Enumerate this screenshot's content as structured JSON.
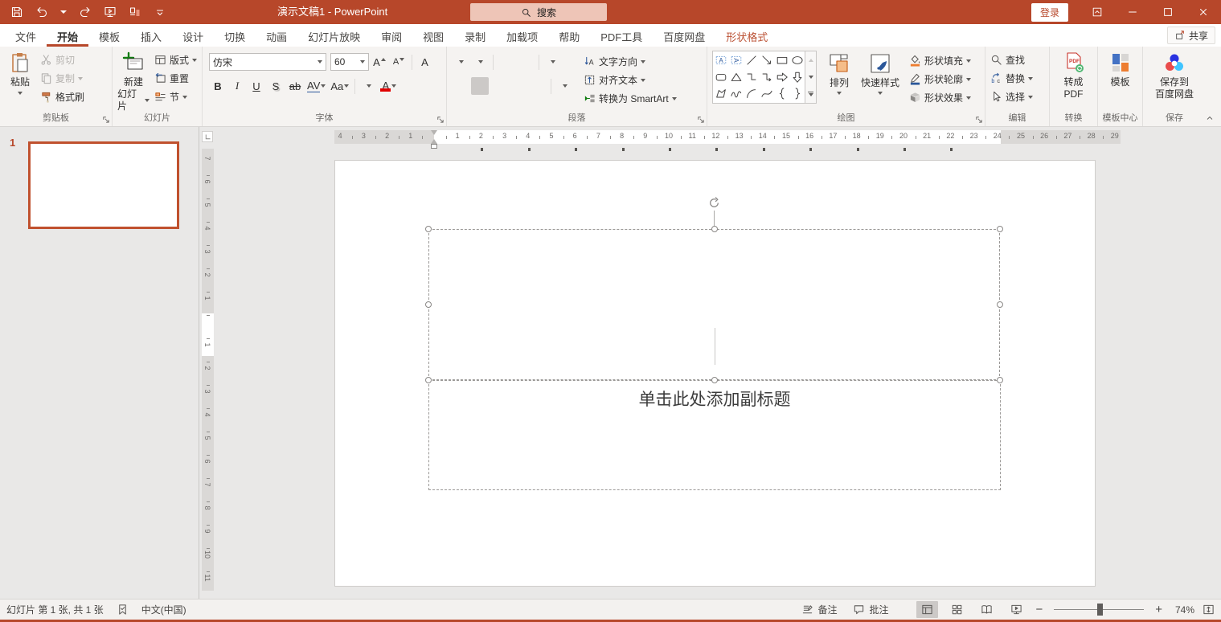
{
  "colors": {
    "accent": "#b7472a",
    "contextual_tab": "#bb5134",
    "thumb_border": "#c0512e",
    "highlight": "#ffff00",
    "font_color": "#e00000"
  },
  "titlebar": {
    "title": "演示文稿1 - PowerPoint",
    "search": "搜索",
    "login": "登录"
  },
  "tabs": [
    {
      "label": "文件"
    },
    {
      "label": "开始",
      "active": true
    },
    {
      "label": "模板"
    },
    {
      "label": "插入"
    },
    {
      "label": "设计"
    },
    {
      "label": "切换"
    },
    {
      "label": "动画"
    },
    {
      "label": "幻灯片放映"
    },
    {
      "label": "审阅"
    },
    {
      "label": "视图"
    },
    {
      "label": "录制"
    },
    {
      "label": "加载项"
    },
    {
      "label": "帮助"
    },
    {
      "label": "PDF工具"
    },
    {
      "label": "百度网盘"
    },
    {
      "label": "形状格式",
      "contextual": true
    }
  ],
  "share": "共享",
  "ribbon": {
    "clipboard": {
      "label": "剪贴板",
      "paste": "粘贴",
      "cut": "剪切",
      "copy": "复制",
      "format_painter": "格式刷"
    },
    "slides": {
      "label": "幻灯片",
      "new_slide_l1": "新建",
      "new_slide_l2": "幻灯片",
      "layout": "版式",
      "reset": "重置",
      "section": "节"
    },
    "font": {
      "label": "字体",
      "family": "仿宋",
      "size": "60",
      "bold": "B",
      "italic": "I",
      "underline": "U",
      "shadow": "S",
      "strike": "ab",
      "spacing": "AV",
      "case": "Aa",
      "grow": "A",
      "shrink": "A",
      "clear": "A",
      "color_letter": "A"
    },
    "paragraph": {
      "label": "段落",
      "text_direction": "文字方向",
      "align_text": "对齐文本",
      "smartart": "转换为 SmartArt"
    },
    "drawing": {
      "label": "绘图",
      "arrange": "排列",
      "quick_styles": "快速样式",
      "fill": "形状填充",
      "outline": "形状轮廓",
      "effects": "形状效果",
      "shapes": [
        "text-box",
        "vertical-text-box",
        "line",
        "arrow",
        "rectangle",
        "oval",
        "rounded-rectangle",
        "triangle",
        "elbow-connector",
        "elbow-arrow-connector",
        "right-arrow",
        "down-arrow",
        "freeform",
        "scribble",
        "arc",
        "curve",
        "left-brace",
        "right-brace"
      ]
    },
    "editing": {
      "label": "编辑",
      "find": "查找",
      "replace": "替换",
      "select": "选择"
    },
    "convert": {
      "label": "转换",
      "l1": "转成",
      "l2": "PDF"
    },
    "template_center": {
      "label": "模板中心",
      "button": "模板"
    },
    "save": {
      "label": "保存",
      "l1": "保存到",
      "l2": "百度网盘"
    }
  },
  "slide_panel": {
    "number": "1"
  },
  "slide": {
    "subtitle_placeholder": "单击此处添加副标题"
  },
  "ruler": {
    "h": {
      "left_numbers": [
        4,
        3,
        2,
        1
      ],
      "right_numbers": [
        1,
        2,
        3,
        4,
        5,
        6,
        7,
        8,
        9,
        10,
        11,
        12,
        13,
        14,
        15,
        16,
        17,
        18,
        19,
        20,
        21,
        22,
        23,
        24,
        25,
        26,
        27,
        28,
        29
      ],
      "unit": 29.2,
      "origin": 124,
      "white_start": 124,
      "white_end": 829,
      "band_width": 978
    },
    "v": {
      "top_numbers": [
        7,
        6,
        5,
        4,
        3,
        2,
        1
      ],
      "bottom_numbers": [
        1,
        2,
        3,
        4,
        5,
        6,
        7,
        8,
        9,
        10,
        11
      ],
      "unit": 29,
      "origin": 221,
      "white_start": 205,
      "white_end": 258,
      "band_height": 550
    }
  },
  "statusbar": {
    "slide_info": "幻灯片 第 1 张, 共 1 张",
    "language": "中文(中国)",
    "notes": "备注",
    "comments": "批注",
    "zoom": "74%"
  }
}
